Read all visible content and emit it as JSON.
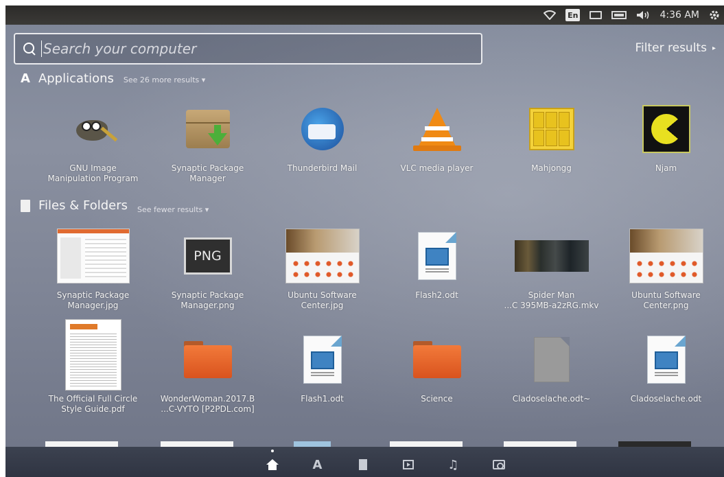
{
  "panel": {
    "keyboard_layout": "En",
    "clock": "4:36 AM",
    "icons": [
      "wifi-icon",
      "keyboard-layout",
      "mail-icon",
      "battery-icon",
      "volume-icon",
      "settings-gear-icon"
    ]
  },
  "search": {
    "placeholder": "Search your computer",
    "value": ""
  },
  "filter": {
    "label": "Filter results",
    "arrow": "▸"
  },
  "applications": {
    "title": "Applications",
    "more_label": "See 26 more results",
    "more_arrow": "▾",
    "items": [
      {
        "label": "GNU Image\nManipulation Program",
        "icon": "gimp-icon"
      },
      {
        "label": "Synaptic Package\nManager",
        "icon": "synaptic-icon"
      },
      {
        "label": "Thunderbird Mail",
        "icon": "thunderbird-icon"
      },
      {
        "label": "VLC media player",
        "icon": "vlc-icon"
      },
      {
        "label": "Mahjongg",
        "icon": "mahjongg-icon"
      },
      {
        "label": "Njam",
        "icon": "njam-icon"
      }
    ]
  },
  "files": {
    "title": "Files & Folders",
    "more_label": "See fewer results",
    "more_arrow": "▾",
    "row1": [
      {
        "label": "Synaptic Package\nManager.jpg",
        "icon": "screenshot-thumbnail"
      },
      {
        "label": "Synaptic Package\nManager.png",
        "icon": "png-file-icon",
        "badge": "PNG"
      },
      {
        "label": "Ubuntu Software\nCenter.jpg",
        "icon": "screenshot-thumbnail"
      },
      {
        "label": "Flash2.odt",
        "icon": "odt-document-icon"
      },
      {
        "label": "Spider Man\n...C 395MB-a2zRG.mkv",
        "icon": "video-thumbnail"
      },
      {
        "label": "Ubuntu Software\nCenter.png",
        "icon": "screenshot-thumbnail"
      }
    ],
    "row2": [
      {
        "label": "The Official Full Circle\nStyle Guide.pdf",
        "icon": "pdf-thumbnail"
      },
      {
        "label": "WonderWoman.2017.B\n...C-VYTO [P2PDL.com]",
        "icon": "folder-icon"
      },
      {
        "label": "Flash1.odt",
        "icon": "odt-document-icon"
      },
      {
        "label": "Science",
        "icon": "folder-icon"
      },
      {
        "label": "Cladoselache.odt~",
        "icon": "blank-file-icon"
      },
      {
        "label": "Cladoselache.odt",
        "icon": "odt-document-icon"
      }
    ]
  },
  "launcher": {
    "lenses": [
      "home-lens-icon",
      "applications-lens-icon",
      "files-lens-icon",
      "video-lens-icon",
      "music-lens-icon",
      "photo-lens-icon"
    ],
    "active": "home-lens-icon"
  }
}
